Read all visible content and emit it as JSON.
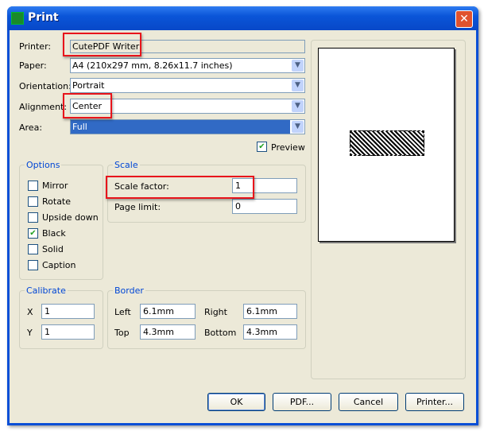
{
  "window": {
    "title": "Print",
    "close": "✕"
  },
  "printer": {
    "label": "Printer:",
    "value": "CutePDF Writer"
  },
  "paper": {
    "label": "Paper:",
    "value": "A4 (210x297 mm, 8.26x11.7 inches)"
  },
  "orientation": {
    "label": "Orientation:",
    "value": "Portrait"
  },
  "alignment": {
    "label": "Alignment:",
    "value": "Center"
  },
  "area": {
    "label": "Area:",
    "value": "Full"
  },
  "preview": {
    "label": "Preview",
    "checked": true
  },
  "options": {
    "title": "Options",
    "items": [
      {
        "label": "Mirror",
        "checked": false
      },
      {
        "label": "Rotate",
        "checked": false
      },
      {
        "label": "Upside down",
        "checked": false
      },
      {
        "label": "Black",
        "checked": true
      },
      {
        "label": "Solid",
        "checked": false
      },
      {
        "label": "Caption",
        "checked": false
      }
    ]
  },
  "scale": {
    "title": "Scale",
    "factor_label": "Scale factor:",
    "factor": "1",
    "limit_label": "Page limit:",
    "limit": "0"
  },
  "calibrate": {
    "title": "Calibrate",
    "x_label": "X",
    "x": "1",
    "y_label": "Y",
    "y": "1"
  },
  "border": {
    "title": "Border",
    "left_label": "Left",
    "left": "6.1mm",
    "right_label": "Right",
    "right": "6.1mm",
    "top_label": "Top",
    "top": "4.3mm",
    "bottom_label": "Bottom",
    "bottom": "4.3mm"
  },
  "buttons": {
    "ok": "OK",
    "pdf": "PDF...",
    "cancel": "Cancel",
    "printer": "Printer..."
  },
  "check_mark": "✔",
  "arrow": "▼"
}
